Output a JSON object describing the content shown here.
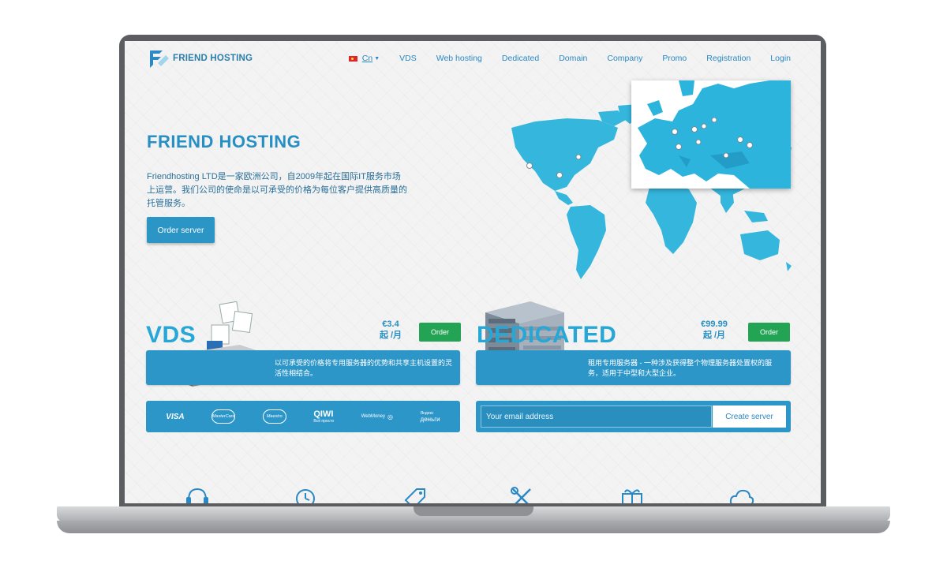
{
  "nav": {
    "logo_text": "FRIEND HOSTING",
    "language": "Cn",
    "links": [
      "VDS",
      "Web hosting",
      "Dedicated",
      "Domain",
      "Company",
      "Promo",
      "Registration",
      "Login"
    ]
  },
  "hero": {
    "title": "FRIEND HOSTING",
    "description": "Friendhosting LTD是一家欧洲公司，自2009年起在国际IT服务市场上运营。我们公司的使命是以可承受的价格为每位客户提供高质量的托管服务。",
    "order_button": "Order server"
  },
  "vds": {
    "title": "VDS",
    "price": "€3.4",
    "period": "起 /月",
    "order": "Order",
    "description": "以可承受的价格将专用服务器的优势和共享主机设置的灵活性相结合。"
  },
  "dedicated": {
    "title": "DEDICATED",
    "price": "€99.99",
    "period": "起 /月",
    "order": "Order",
    "description": "租用专用服务器 - 一种涉及获得整个物理服务器处置权的服务，适用于中型和大型企业。"
  },
  "payments": {
    "visa": "VISA",
    "mastercard": "MasterCard",
    "maestro": "Maestro",
    "qiwi": "QIWI",
    "qiwi_sub": "Всё просто",
    "webmoney": "WebMoney",
    "yandex_top": "Яндекс",
    "yandex": "деньги"
  },
  "signup": {
    "email_placeholder": "Your email address",
    "create_button": "Create server"
  },
  "colors": {
    "accent": "#2b95c6",
    "title": "#2690c4",
    "order_green": "#23a454",
    "map_blue": "#35b6dd"
  },
  "feature_icons": [
    "headset-icon",
    "clock-icon",
    "tag-icon",
    "tools-icon",
    "gift-icon",
    "cloud-icon"
  ]
}
